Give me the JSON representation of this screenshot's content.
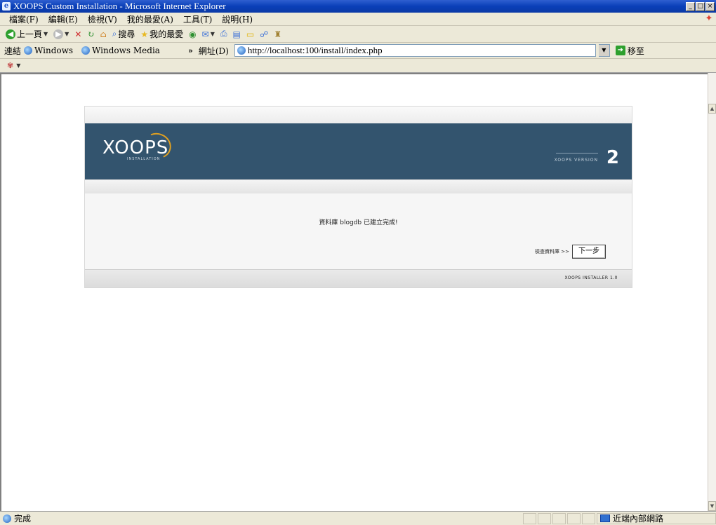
{
  "window": {
    "title": "XOOPS Custom Installation - Microsoft Internet Explorer",
    "controls": [
      "_",
      "□",
      "×"
    ]
  },
  "menu": [
    "檔案(F)",
    "編輯(E)",
    "檢視(V)",
    "我的最愛(A)",
    "工具(T)",
    "說明(H)"
  ],
  "toolbar": {
    "back": "上一頁",
    "search": "搜尋",
    "favorites": "我的最愛"
  },
  "links": {
    "label": "連結",
    "items": [
      "Windows",
      "Windows Media"
    ],
    "chevron": "»"
  },
  "address": {
    "label": "網址(D)",
    "url": "http://localhost:100/install/index.php",
    "go_label": "移至"
  },
  "installer": {
    "logo": "XOOPS",
    "logo_sub": "INSTALLATION",
    "version_label": "XOOPS VERSION",
    "version_number": "2",
    "message": "資料庫 blogdb 已建立完成!",
    "next_prefix": "檢查資料庫 >>",
    "next_button": "下一步",
    "footer": "XOOPS INSTALLER 1.0"
  },
  "status": {
    "text": "完成",
    "zone": "近端內部網路"
  }
}
